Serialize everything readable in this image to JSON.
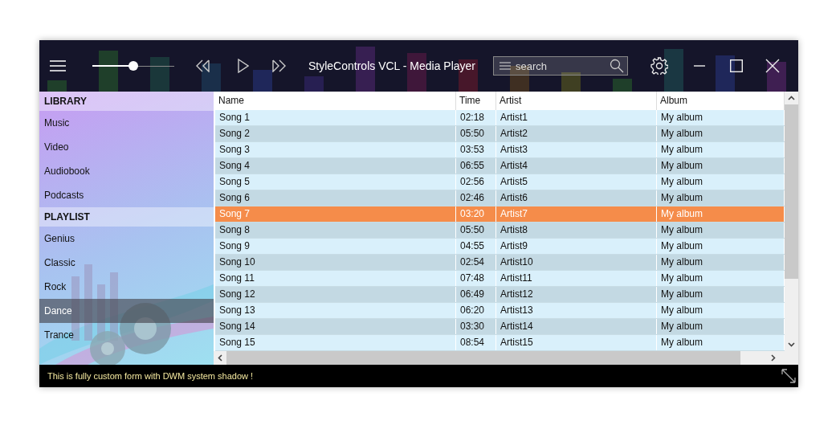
{
  "window": {
    "title": "StyleControls VCL - Media Player"
  },
  "toolbar": {
    "volume": {
      "level": 0.5
    },
    "search": {
      "placeholder": "search"
    }
  },
  "sidebar": {
    "sections": [
      {
        "title": "LIBRARY",
        "items": [
          {
            "label": "Music",
            "selected": false
          },
          {
            "label": "Video",
            "selected": false
          },
          {
            "label": "Audiobook",
            "selected": false
          },
          {
            "label": "Podcasts",
            "selected": false
          }
        ]
      },
      {
        "title": "PLAYLIST",
        "items": [
          {
            "label": "Genius",
            "selected": false
          },
          {
            "label": "Classic",
            "selected": false
          },
          {
            "label": "Rock",
            "selected": false
          },
          {
            "label": "Dance",
            "selected": true
          },
          {
            "label": "Trance",
            "selected": false
          }
        ]
      }
    ]
  },
  "table": {
    "columns": [
      "Name",
      "Time",
      "Artist",
      "Album"
    ],
    "rows": [
      {
        "cells": [
          "Song 1",
          "02:18",
          "Artist1",
          "My album"
        ],
        "selected": false
      },
      {
        "cells": [
          "Song 2",
          "05:50",
          "Artist2",
          "My album"
        ],
        "selected": false
      },
      {
        "cells": [
          "Song 3",
          "03:53",
          "Artist3",
          "My album"
        ],
        "selected": false
      },
      {
        "cells": [
          "Song 4",
          "06:55",
          "Artist4",
          "My album"
        ],
        "selected": false
      },
      {
        "cells": [
          "Song 5",
          "02:56",
          "Artist5",
          "My album"
        ],
        "selected": false
      },
      {
        "cells": [
          "Song 6",
          "02:46",
          "Artist6",
          "My album"
        ],
        "selected": false
      },
      {
        "cells": [
          "Song 7",
          "03:20",
          "Artist7",
          "My album"
        ],
        "selected": true
      },
      {
        "cells": [
          "Song 8",
          "05:50",
          "Artist8",
          "My album"
        ],
        "selected": false
      },
      {
        "cells": [
          "Song 9",
          "04:55",
          "Artist9",
          "My album"
        ],
        "selected": false
      },
      {
        "cells": [
          "Song 10",
          "02:54",
          "Artist10",
          "My album"
        ],
        "selected": false
      },
      {
        "cells": [
          "Song 11",
          "07:48",
          "Artist11",
          "My album"
        ],
        "selected": false
      },
      {
        "cells": [
          "Song 12",
          "06:49",
          "Artist12",
          "My album"
        ],
        "selected": false
      },
      {
        "cells": [
          "Song 13",
          "06:20",
          "Artist13",
          "My album"
        ],
        "selected": false
      },
      {
        "cells": [
          "Song 14",
          "03:30",
          "Artist14",
          "My album"
        ],
        "selected": false
      },
      {
        "cells": [
          "Song 15",
          "08:54",
          "Artist15",
          "My album"
        ],
        "selected": false
      }
    ]
  },
  "status_bar": {
    "text": "This is fully custom form with DWM system shadow !"
  }
}
